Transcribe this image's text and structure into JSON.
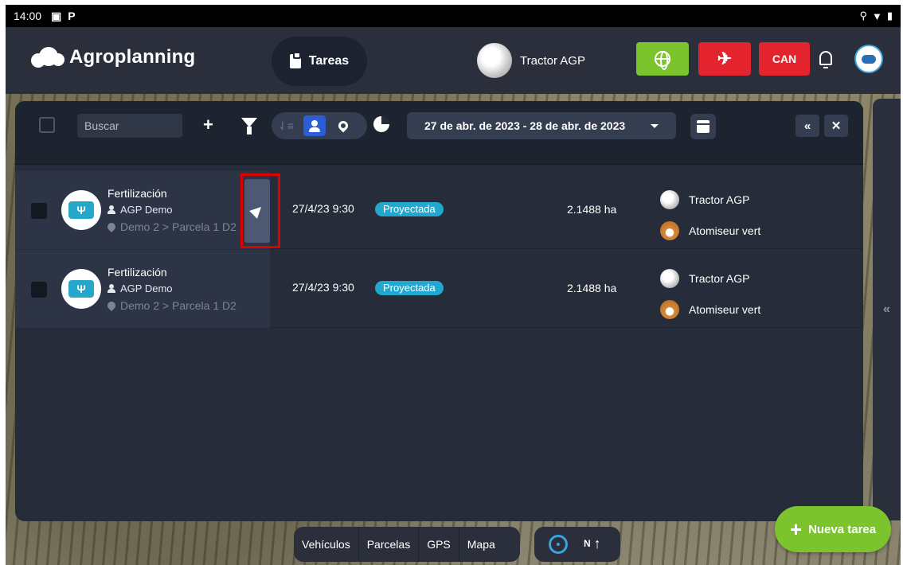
{
  "status_bar": {
    "time": "14:00",
    "left_icons": [
      "image-icon",
      "parking-icon"
    ],
    "right_icons": [
      "location-icon",
      "wifi-icon",
      "battery-icon"
    ]
  },
  "app": {
    "name": "Agroplanning"
  },
  "header": {
    "tab_label": "Tareas",
    "vehicle_name": "Tractor AGP",
    "can_label": "CAN",
    "colors": {
      "globe_button": "#7cc42e",
      "satellite_button": "#e3242e",
      "can_button": "#e3242e"
    }
  },
  "toolbar": {
    "search_placeholder": "Buscar",
    "date_range": "27 de abr. de 2023 - 28 de abr. de 2023"
  },
  "tasks": [
    {
      "title": "Fertilización",
      "owner": "AGP Demo",
      "location": "Demo 2 > Parcela 1 D2",
      "datetime": "27/4/23 9:30",
      "status": "Proyectada",
      "area": "2.1488 ha",
      "equipment": [
        "Tractor AGP",
        "Atomiseur vert"
      ],
      "has_navigate_button": true
    },
    {
      "title": "Fertilización",
      "owner": "AGP Demo",
      "location": "Demo 2 > Parcela 1 D2",
      "datetime": "27/4/23 9:30",
      "status": "Proyectada",
      "area": "2.1488 ha",
      "equipment": [
        "Tractor AGP",
        "Atomiseur vert"
      ],
      "has_navigate_button": false
    }
  ],
  "bottom_bar": {
    "items": [
      "Vehículos",
      "Parcelas",
      "GPS",
      "Mapa"
    ],
    "north_label": "N"
  },
  "fab": {
    "label": "Nueva tarea"
  },
  "accent_colors": {
    "status_badge": "#22a8cf",
    "highlight": "#e00000",
    "primary_blue": "#2b5ed6"
  }
}
